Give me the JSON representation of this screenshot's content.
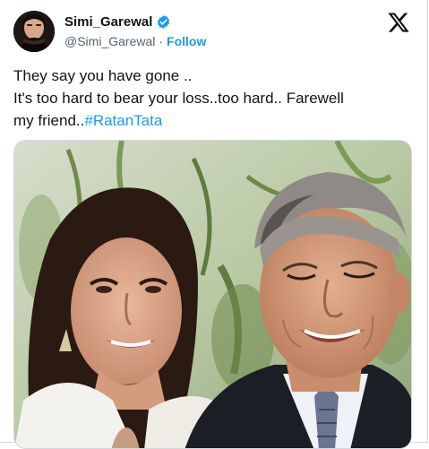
{
  "author": {
    "display_name": "Simi_Garewal",
    "handle": "@Simi_Garewal",
    "separator": "·",
    "follow_label": "Follow",
    "verified_badge": "verified-badge-icon"
  },
  "tweet": {
    "line1": "They say you have gone ..",
    "line2": "It's too hard to bear your loss..too hard.. Farewell",
    "line3_prefix": "my friend..",
    "hashtag": "#RatanTata"
  },
  "colors": {
    "accent": "#1d9bf0",
    "text": "#0f1419",
    "muted": "#536471",
    "border": "#cfd9de"
  },
  "icons": {
    "platform_logo": "x-logo-icon",
    "verified": "blue-check-icon"
  }
}
